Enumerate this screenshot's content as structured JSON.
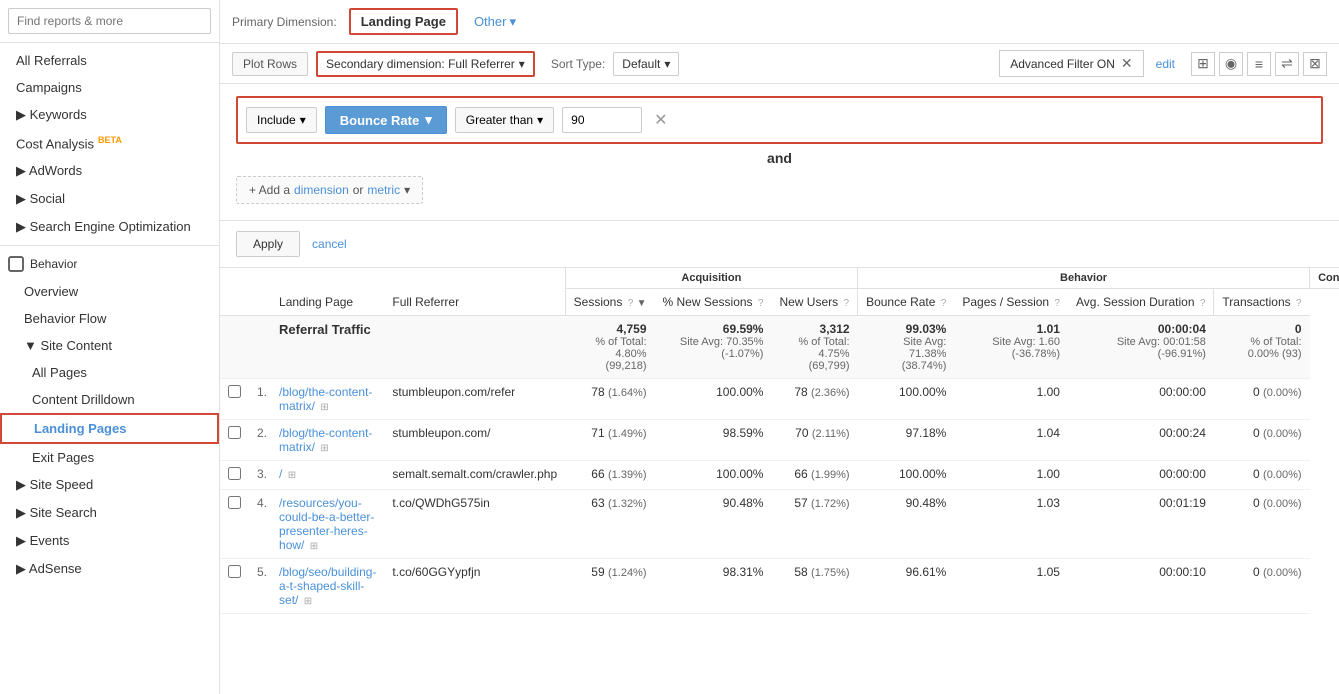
{
  "sidebar": {
    "search_placeholder": "Find reports & more",
    "nav_items": [
      {
        "id": "all-referrals",
        "label": "All Referrals",
        "indent": 0
      },
      {
        "id": "campaigns",
        "label": "Campaigns",
        "indent": 0
      },
      {
        "id": "keywords",
        "label": "▶ Keywords",
        "indent": 0
      },
      {
        "id": "cost-analysis",
        "label": "Cost Analysis",
        "indent": 0,
        "badge": "BETA"
      },
      {
        "id": "adwords",
        "label": "▶ AdWords",
        "indent": 0
      },
      {
        "id": "social",
        "label": "▶ Social",
        "indent": 0
      },
      {
        "id": "seo",
        "label": "▶ Search Engine Optimization",
        "indent": 0
      }
    ],
    "behavior_section": "Behavior",
    "behavior_items": [
      {
        "id": "overview",
        "label": "Overview",
        "indent": 1
      },
      {
        "id": "behavior-flow",
        "label": "Behavior Flow",
        "indent": 1
      },
      {
        "id": "site-content",
        "label": "▼ Site Content",
        "indent": 1
      },
      {
        "id": "all-pages",
        "label": "All Pages",
        "indent": 2
      },
      {
        "id": "content-drilldown",
        "label": "Content Drilldown",
        "indent": 2
      },
      {
        "id": "landing-pages",
        "label": "Landing Pages",
        "indent": 2,
        "active": true
      },
      {
        "id": "exit-pages",
        "label": "Exit Pages",
        "indent": 2
      }
    ],
    "speed_section": "▶ Site Speed",
    "search_section": "▶ Site Search",
    "events_section": "▶ Events",
    "adsense_section": "▶ AdSense"
  },
  "topbar": {
    "primary_dim_label": "Primary Dimension:",
    "landing_page_tab": "Landing Page",
    "other_btn": "Other",
    "other_dropdown_arrow": "▾"
  },
  "secondbar": {
    "plot_rows_label": "Plot Rows",
    "secondary_dim_label": "Secondary dimension: Full Referrer",
    "secondary_dim_arrow": "▾",
    "sort_type_label": "Sort Type:",
    "sort_default_label": "Default",
    "sort_arrow": "▾",
    "advanced_filter_label": "Advanced Filter ON",
    "edit_label": "edit"
  },
  "filter": {
    "include_label": "Include",
    "include_arrow": "▾",
    "bounce_rate_label": "Bounce Rate",
    "bounce_rate_arrow": "▾",
    "greater_than_label": "Greater than",
    "greater_than_arrow": "▾",
    "value": "90",
    "and_label": "and",
    "add_btn": "+ Add a",
    "dimension_link": "dimension",
    "or_text": "or",
    "metric_link": "metric",
    "metric_arrow": "▾"
  },
  "apply_row": {
    "apply_label": "Apply",
    "cancel_label": "cancel"
  },
  "table": {
    "group_headers": [
      {
        "label": "Acquisition",
        "colspan": 3
      },
      {
        "label": "Behavior",
        "colspan": 4
      },
      {
        "label": "Conversions",
        "colspan": 2
      }
    ],
    "columns": [
      {
        "id": "landing-page",
        "label": "Landing Page",
        "has_help": true
      },
      {
        "id": "full-referrer",
        "label": "Full Referrer",
        "has_help": true
      },
      {
        "id": "sessions",
        "label": "Sessions",
        "has_help": true,
        "sort": "▼",
        "group": "acquisition"
      },
      {
        "id": "pct-new-sessions",
        "label": "% New Sessions",
        "has_help": true,
        "group": "acquisition"
      },
      {
        "id": "new-users",
        "label": "New Users",
        "has_help": true,
        "group": "acquisition"
      },
      {
        "id": "bounce-rate",
        "label": "Bounce Rate",
        "has_help": true,
        "group": "behavior"
      },
      {
        "id": "pages-session",
        "label": "Pages / Session",
        "has_help": true,
        "group": "behavior"
      },
      {
        "id": "avg-session",
        "label": "Avg. Session Duration",
        "has_help": true,
        "group": "behavior"
      },
      {
        "id": "transactions",
        "label": "Transactions",
        "has_help": true,
        "group": "conversions"
      }
    ],
    "summary": {
      "label": "Referral Traffic",
      "sessions": "4,759",
      "sessions_sub": "% of Total: 4.80% (99,218)",
      "pct_new": "69.59%",
      "pct_new_sub": "Site Avg: 70.35% (-1.07%)",
      "new_users": "3,312",
      "new_users_sub": "% of Total: 4.75% (69,799)",
      "bounce_rate": "99.03%",
      "bounce_rate_sub": "Site Avg: 71.38% (38.74%)",
      "pages_session": "1.01",
      "pages_session_sub": "Site Avg: 1.60 (-36.78%)",
      "avg_session": "00:00:04",
      "avg_session_sub": "Site Avg: 00:01:58 (-96.91%)",
      "transactions": "0",
      "transactions_sub": "% of Total: 0.00% (93)"
    },
    "rows": [
      {
        "num": "1",
        "landing_page": "/blog/the-content-matrix/",
        "referrer": "stumbleupon.com/refer",
        "sessions": "78",
        "sessions_pct": "(1.64%)",
        "pct_new": "100.00%",
        "new_users": "78",
        "new_users_pct": "(2.36%)",
        "bounce_rate": "100.00%",
        "pages_session": "1.00",
        "avg_session": "00:00:00",
        "transactions": "0",
        "transactions_pct": "(0.00%)"
      },
      {
        "num": "2",
        "landing_page": "/blog/the-content-matrix/",
        "referrer": "stumbleupon.com/",
        "sessions": "71",
        "sessions_pct": "(1.49%)",
        "pct_new": "98.59%",
        "new_users": "70",
        "new_users_pct": "(2.11%)",
        "bounce_rate": "97.18%",
        "pages_session": "1.04",
        "avg_session": "00:00:24",
        "transactions": "0",
        "transactions_pct": "(0.00%)"
      },
      {
        "num": "3",
        "landing_page": "/",
        "referrer": "semalt.semalt.com/crawler.php",
        "sessions": "66",
        "sessions_pct": "(1.39%)",
        "pct_new": "100.00%",
        "new_users": "66",
        "new_users_pct": "(1.99%)",
        "bounce_rate": "100.00%",
        "pages_session": "1.00",
        "avg_session": "00:00:00",
        "transactions": "0",
        "transactions_pct": "(0.00%)"
      },
      {
        "num": "4",
        "landing_page": "/resources/you-could-be-a-better-presenter-heres-how/",
        "referrer": "t.co/QWDhG575in",
        "sessions": "63",
        "sessions_pct": "(1.32%)",
        "pct_new": "90.48%",
        "new_users": "57",
        "new_users_pct": "(1.72%)",
        "bounce_rate": "90.48%",
        "pages_session": "1.03",
        "avg_session": "00:01:19",
        "transactions": "0",
        "transactions_pct": "(0.00%)"
      },
      {
        "num": "5",
        "landing_page": "/blog/seo/building-a-t-shaped-skill-set/",
        "referrer": "t.co/60GGYypfjn",
        "sessions": "59",
        "sessions_pct": "(1.24%)",
        "pct_new": "98.31%",
        "new_users": "58",
        "new_users_pct": "(1.75%)",
        "bounce_rate": "96.61%",
        "pages_session": "1.05",
        "avg_session": "00:00:10",
        "transactions": "0",
        "transactions_pct": "(0.00%)"
      }
    ]
  }
}
